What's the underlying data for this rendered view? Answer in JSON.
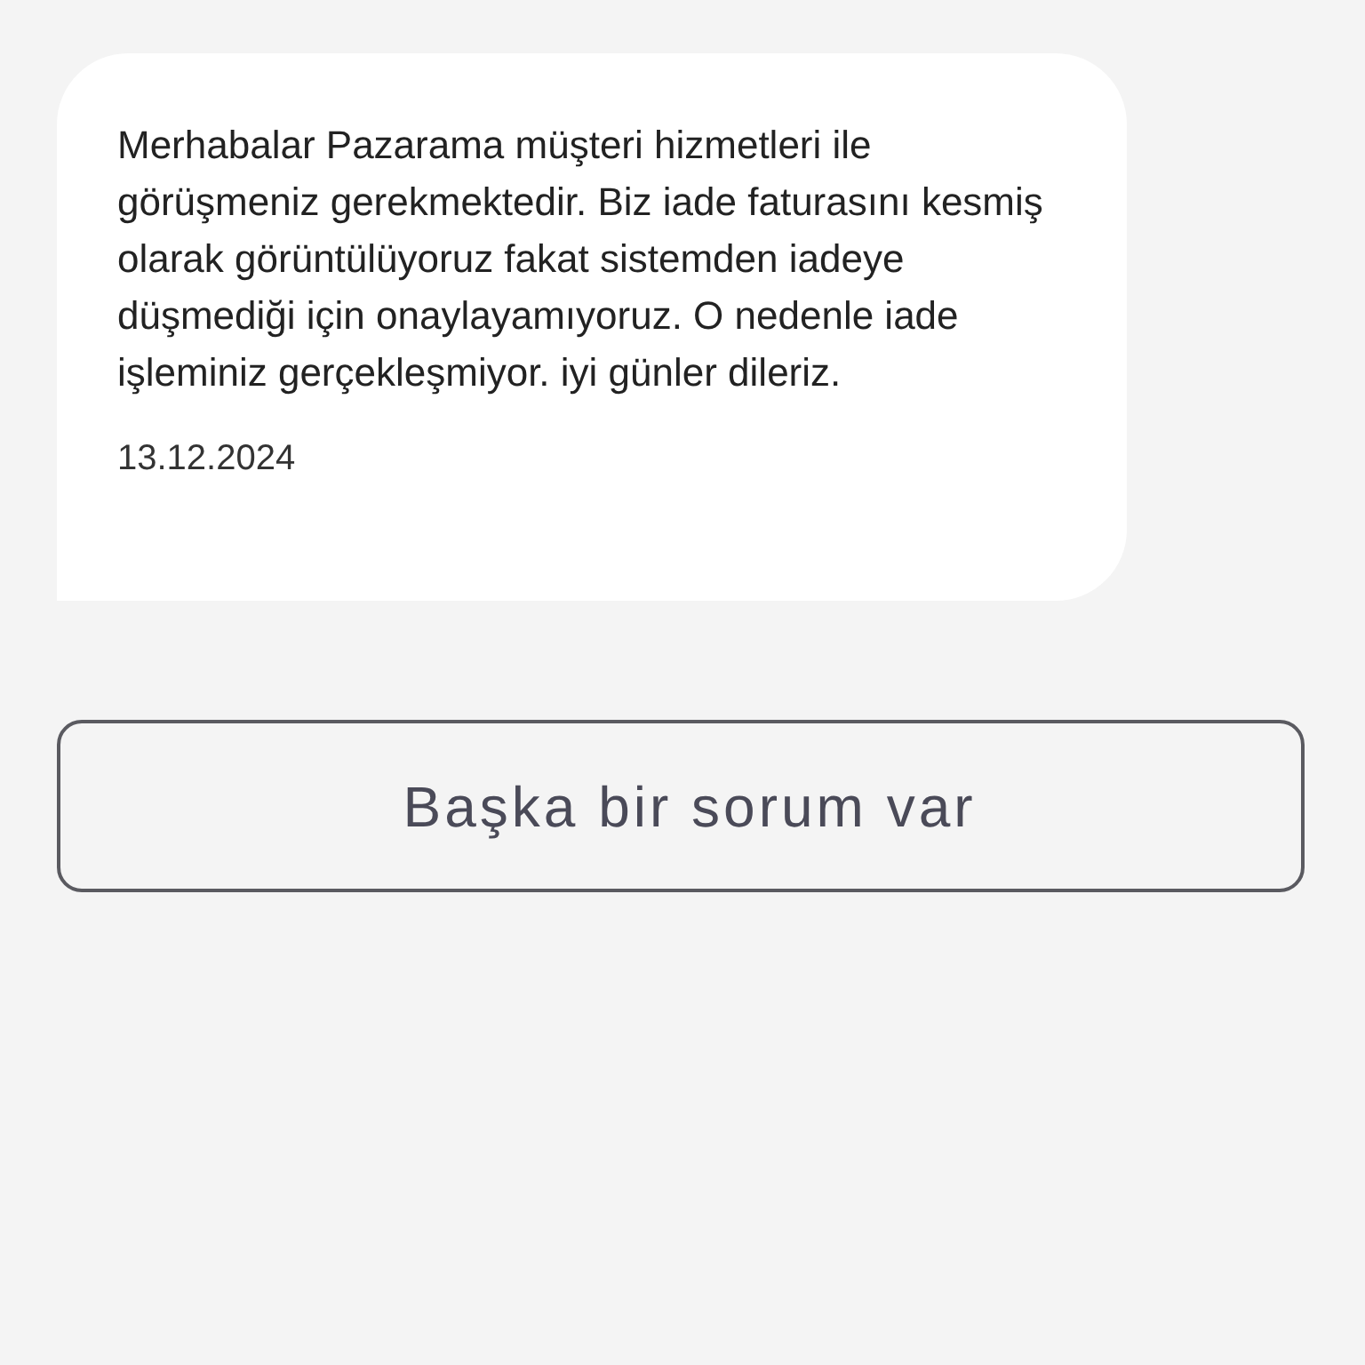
{
  "message": {
    "text": "Merhabalar Pazarama müşteri hizmetleri ile görüşmeniz gerekmektedir. Biz iade faturasını kesmiş olarak görüntülüyoruz fakat sistemden iadeye düşmediği için onaylayamıyoruz. O nedenle iade işleminiz gerçekleşmiyor. iyi günler dileriz.",
    "date": "13.12.2024"
  },
  "buttons": [
    "Başka bir sorum var"
  ]
}
